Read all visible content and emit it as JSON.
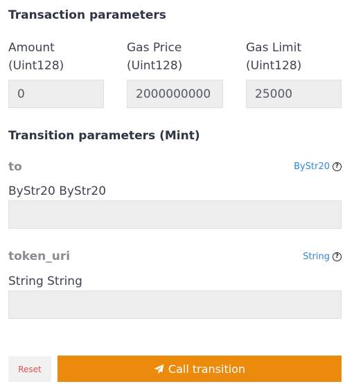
{
  "transaction": {
    "title": "Transaction parameters",
    "fields": [
      {
        "label_line1": "Amount",
        "label_line2": "(Uint128)",
        "value": "0"
      },
      {
        "label_line1": "Gas Price",
        "label_line2": "(Uint128)",
        "value": "2000000000"
      },
      {
        "label_line1": "Gas Limit",
        "label_line2": "(Uint128)",
        "value": "25000"
      }
    ]
  },
  "transition": {
    "title": "Transition parameters (Mint)",
    "params": [
      {
        "name": "to",
        "type": "ByStr20",
        "description": "ByStr20 ByStr20",
        "value": ""
      },
      {
        "name": "token_uri",
        "type": "String",
        "description": "String String",
        "value": ""
      }
    ]
  },
  "actions": {
    "reset_label": "Reset",
    "call_label": "Call transition",
    "call_icon": "paper-plane-icon",
    "call_color": "#ec8a0c",
    "reset_color": "#d9534f"
  }
}
